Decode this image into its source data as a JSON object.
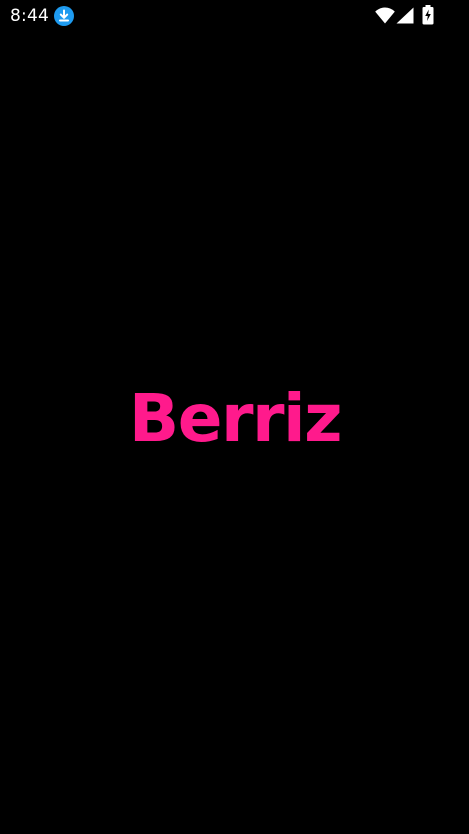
{
  "status_bar": {
    "time": "8:44",
    "download_badge_color": "#1e9bf0",
    "icons": [
      "download-icon",
      "wifi-icon",
      "signal-icon",
      "battery-charging-icon"
    ]
  },
  "splash": {
    "background": "#000000",
    "logo_text": "Berriz",
    "logo_color": "#ff1a8c"
  }
}
